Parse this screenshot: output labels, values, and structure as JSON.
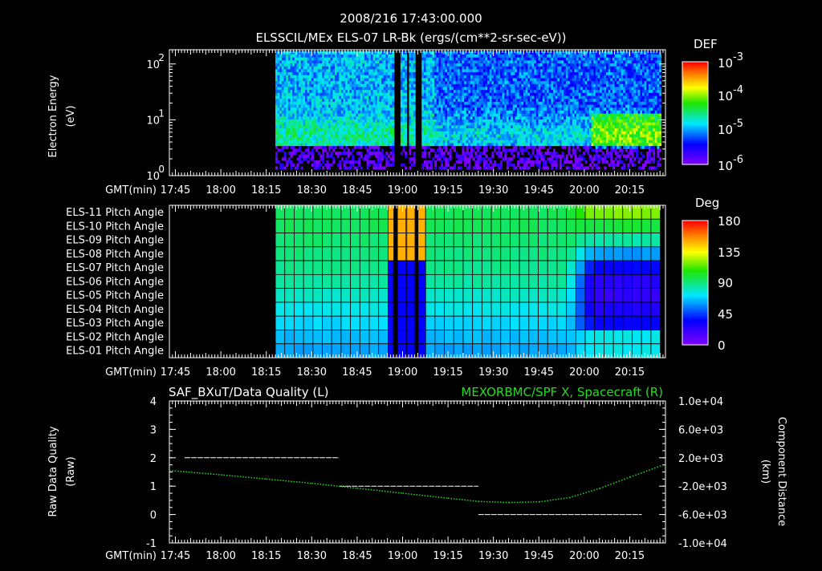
{
  "header": {
    "time": "2008/216 17:43:00.000",
    "title": "ELSSCIL/MEx ELS-07 LR-Bk  (ergs/(cm**2-sr-sec-eV))"
  },
  "time_axis": {
    "label": "GMT(min)",
    "ticks": [
      "17:45",
      "18:00",
      "18:15",
      "18:30",
      "18:45",
      "19:00",
      "19:15",
      "19:30",
      "19:45",
      "20:00",
      "20:15"
    ],
    "start_min": 1063,
    "end_min": 1226.8
  },
  "chart_data": [
    {
      "type": "heatmap",
      "name": "energy-spectrogram",
      "ylabel": "Electron Energy",
      "yunit": "(eV)",
      "yticks": [
        "10",
        "10",
        "10"
      ],
      "yticks_exp": [
        "0",
        "1",
        "2"
      ],
      "ylim": [
        1,
        180
      ],
      "yscale": "log",
      "colorbar": {
        "title": "DEF",
        "labels": [
          "10",
          "10",
          "10",
          "10"
        ],
        "exps": [
          "-3",
          "-4",
          "-5",
          "-6"
        ],
        "range": [
          1e-06,
          0.001
        ]
      },
      "data_start": "18:18",
      "gaps": [
        [
          "18:57",
          "18:59"
        ],
        [
          "19:01",
          "19:02"
        ],
        [
          "19:04",
          "19:06"
        ]
      ]
    },
    {
      "type": "heatmap",
      "name": "pitch-angle",
      "rows": [
        "ELS-11 Pitch Angle",
        "ELS-10 Pitch Angle",
        "ELS-09 Pitch Angle",
        "ELS-08 Pitch Angle",
        "ELS-07 Pitch Angle",
        "ELS-06 Pitch Angle",
        "ELS-05 Pitch Angle",
        "ELS-04 Pitch Angle",
        "ELS-03 Pitch Angle",
        "ELS-02 Pitch Angle",
        "ELS-01 Pitch Angle"
      ],
      "row_values_early": [
        95,
        95,
        92,
        90,
        88,
        85,
        80,
        75,
        70,
        65,
        62
      ],
      "colorbar": {
        "title": "Deg",
        "labels": [
          "180",
          "135",
          "90",
          "45",
          "0"
        ],
        "range": [
          0,
          180
        ]
      }
    },
    {
      "type": "line",
      "name": "data-quality",
      "left_title": "SAF_BXuT/Data Quality (L)",
      "right_title": "MEXORBMC/SPF X, Spacecraft (R)",
      "ylabel_left": [
        "Raw Data Quality",
        "(Raw)"
      ],
      "ylabel_right": [
        "Component Distance",
        "(km)"
      ],
      "yticks_left": [
        "4",
        "3",
        "2",
        "1",
        "0",
        "-1"
      ],
      "ylim_left": [
        -1,
        4
      ],
      "yticks_right": [
        "1.0e+04",
        "6.0e+03",
        "2.0e+03",
        "-2.0e+03",
        "-6.0e+03",
        "-1.0e+04"
      ],
      "ylim_right": [
        -10000,
        10000
      ],
      "series": [
        {
          "name": "Data Quality",
          "color": "#ffffff",
          "segments": [
            [
              1068,
              1119,
              2
            ],
            [
              1119,
              1165,
              1
            ],
            [
              1165,
              1219,
              0
            ]
          ]
        },
        {
          "name": "Spacecraft X (km)",
          "color": "#22dd22",
          "x": [
            1063,
            1080,
            1095,
            1110,
            1125,
            1140,
            1155,
            1165,
            1175,
            1185,
            1195,
            1205,
            1215,
            1226
          ],
          "y": [
            200,
            -400,
            -1000,
            -1600,
            -2300,
            -3000,
            -3700,
            -4150,
            -4300,
            -4200,
            -3600,
            -2300,
            -700,
            1000
          ]
        }
      ]
    }
  ]
}
